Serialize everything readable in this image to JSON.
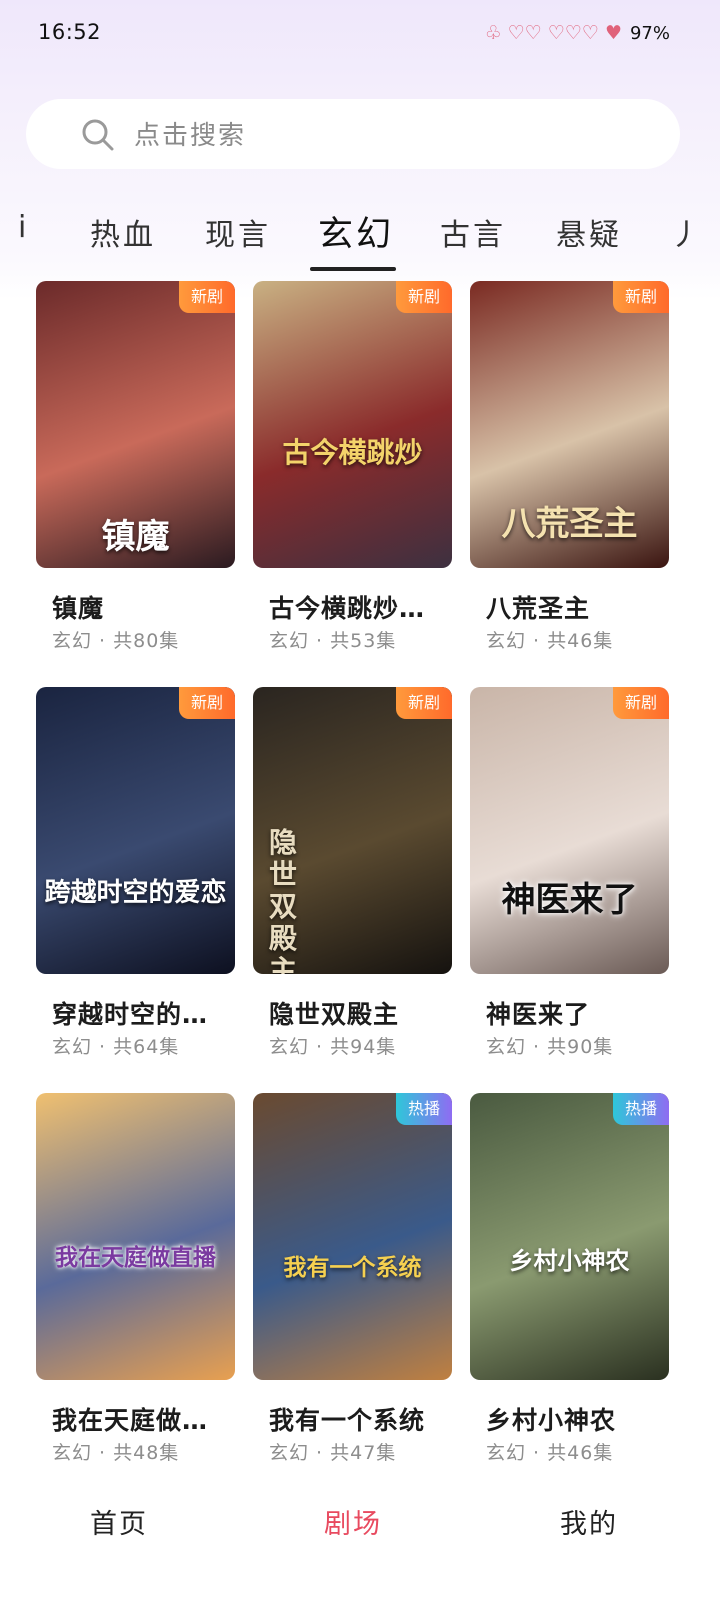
{
  "status_bar": {
    "time": "16:52",
    "battery": "97%"
  },
  "search": {
    "placeholder": "点击搜索"
  },
  "tabs": [
    {
      "label": "热血"
    },
    {
      "label": "现言"
    },
    {
      "label": "玄幻"
    },
    {
      "label": "古言"
    },
    {
      "label": "悬疑"
    }
  ],
  "active_tab": "玄幻",
  "cards": [
    {
      "title": "镇魔",
      "meta": "玄幻 · 共80集",
      "badge": "新剧",
      "badge_type": "new",
      "poster_text": "镇魔",
      "colors": [
        "#6b2a2a",
        "#c96a5a",
        "#2a1a20"
      ]
    },
    {
      "title": "古今横跳炒…",
      "meta": "玄幻 · 共53集",
      "badge": "新剧",
      "badge_type": "new",
      "poster_text": "古今横跳炒",
      "colors": [
        "#c9b183",
        "#8a2b2b",
        "#3d3040"
      ]
    },
    {
      "title": "八荒圣主",
      "meta": "玄幻 · 共46集",
      "badge": "新剧",
      "badge_type": "new",
      "poster_text": "八荒圣主",
      "colors": [
        "#7a2a22",
        "#d8c2a8",
        "#3a1410"
      ]
    },
    {
      "title": "穿越时空的…",
      "meta": "玄幻 · 共64集",
      "badge": "新剧",
      "badge_type": "new",
      "poster_text": "跨越时空的爱恋",
      "colors": [
        "#1a2440",
        "#3a4a70",
        "#0d1020"
      ]
    },
    {
      "title": "隐世双殿主",
      "meta": "玄幻 · 共94集",
      "badge": "新剧",
      "badge_type": "new",
      "poster_text": "隐世双殿主",
      "colors": [
        "#2a2520",
        "#5a4a30",
        "#15120f"
      ]
    },
    {
      "title": "神医来了",
      "meta": "玄幻 · 共90集",
      "badge": "新剧",
      "badge_type": "new",
      "poster_text": "神医来了",
      "colors": [
        "#c9b5a8",
        "#e8dcd5",
        "#6a5a55"
      ]
    },
    {
      "title": "我在天庭做…",
      "meta": "玄幻 · 共48集",
      "badge": "",
      "badge_type": "",
      "poster_text": "我在天庭做直播",
      "colors": [
        "#f0c070",
        "#5a6a9a",
        "#e8a050"
      ]
    },
    {
      "title": "我有一个系统",
      "meta": "玄幻 · 共47集",
      "badge": "热播",
      "badge_type": "hot",
      "poster_text": "我有一个系统",
      "colors": [
        "#6a4a30",
        "#3a5a8a",
        "#c08040"
      ]
    },
    {
      "title": "乡村小神农",
      "meta": "玄幻 · 共46集",
      "badge": "热播",
      "badge_type": "hot",
      "poster_text": "乡村小神农",
      "colors": [
        "#4a5a40",
        "#8a9a70",
        "#2a3020"
      ]
    }
  ],
  "bottom_nav": [
    {
      "label": "首页"
    },
    {
      "label": "剧场"
    },
    {
      "label": "我的"
    }
  ],
  "active_nav": "剧场"
}
